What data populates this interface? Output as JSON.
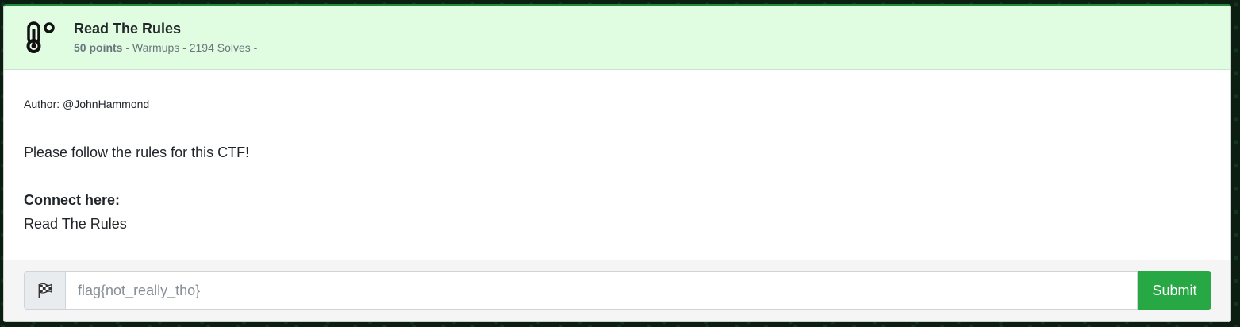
{
  "challenge": {
    "icon": "thermometer-icon",
    "title": "Read The Rules",
    "points": "50 points",
    "meta_rest": " - Warmups - 2194 Solves -",
    "author": "Author: @JohnHammond",
    "description": "Please follow the rules for this CTF!",
    "connect_label": "Connect here:",
    "connect_value": "Read The Rules"
  },
  "flag_form": {
    "prepend_icon": "checkered-flag-icon",
    "placeholder": "flag{not_really_tho}",
    "value": "",
    "submit_label": "Submit"
  },
  "colors": {
    "header_bg": "#e0fde2",
    "top_border": "#1f8a3a",
    "submit_bg": "#28a745",
    "page_bg": "#0c1d12"
  }
}
